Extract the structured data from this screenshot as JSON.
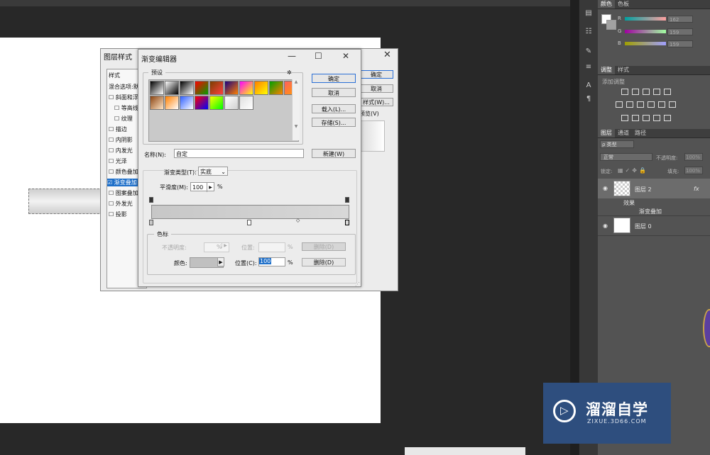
{
  "panels": {
    "color_tabs": [
      "颜色",
      "色板"
    ],
    "channels": [
      {
        "label": "R",
        "value": "162"
      },
      {
        "label": "G",
        "value": "159"
      },
      {
        "label": "B",
        "value": "159"
      }
    ],
    "adjust_tabs": [
      "调整",
      "样式"
    ],
    "adjust_title": "添加调整",
    "layers_tabs": [
      "图层",
      "通道",
      "路径"
    ],
    "filter_label": "ρ 类型",
    "blend_mode": "正常",
    "opacity_label": "不透明度:",
    "opacity_value": "100%",
    "lock_label": "锁定:",
    "fill_label": "填充:",
    "fill_value": "100%",
    "layers": [
      {
        "name": "图层 2",
        "fx": "fx"
      },
      {
        "name": "图层 0"
      }
    ],
    "effects_label": "效果",
    "effect_item": "渐变叠加"
  },
  "layer_style": {
    "title": "图层样式",
    "list_header": "样式",
    "items": [
      {
        "label": "混合选项:默"
      },
      {
        "label": "☐ 斜面和浮"
      },
      {
        "label": "☐ 等高线"
      },
      {
        "label": "☐ 纹理"
      },
      {
        "label": "☐ 描边"
      },
      {
        "label": "☐ 内阴影"
      },
      {
        "label": "☐ 内发光"
      },
      {
        "label": "☐ 光泽"
      },
      {
        "label": "☐ 颜色叠加"
      },
      {
        "label": "☑ 渐变叠加"
      },
      {
        "label": "☐ 图案叠加"
      },
      {
        "label": "☐ 外发光"
      },
      {
        "label": "☐ 投影"
      }
    ],
    "buttons": [
      "确定",
      "取消",
      "样式(W)...",
      "预览(V)"
    ]
  },
  "gradient_editor": {
    "title": "渐变编辑器",
    "presets_label": "预设",
    "buttons": {
      "ok": "确定",
      "cancel": "取消",
      "load": "载入(L)...",
      "save": "存储(S)...",
      "new": "新建(W)"
    },
    "name_label": "名称(N):",
    "name_value": "自定",
    "type_label": "渐变类型(T):",
    "type_value": "实底",
    "smooth_label": "平滑度(M):",
    "smooth_value": "100",
    "percent": "%",
    "stops_label": "色标",
    "opacity_label": "不透明度:",
    "location_label": "位置:",
    "delete_label": "删除(D)",
    "color_label": "颜色:",
    "color_location_label": "位置(C):",
    "color_location_value": "100",
    "color_delete_label": "删除(D)",
    "swatch_colors": [
      [
        "#000000",
        "#ffffff"
      ],
      [
        "#ffffff",
        "#000000"
      ],
      [
        "#000000",
        "#ffffff"
      ],
      [
        "#ff0000",
        "#00a000"
      ],
      [
        "#7b3f00",
        "#ff4040"
      ],
      [
        "#1a0080",
        "#ff8000"
      ],
      [
        "#ff00ff",
        "#ffff00"
      ],
      [
        "#ff8000",
        "#ffff00"
      ],
      [
        "#00a000",
        "#ff8000"
      ],
      [
        "#ff6060",
        "#ffa000"
      ],
      [
        "#8b4513",
        "#ffe4c4"
      ],
      [
        "#ff8000",
        "#ffffff"
      ],
      [
        "#3060ff",
        "#ffffff"
      ],
      [
        "#ff0000",
        "#0000ff"
      ],
      [
        "#ffff00",
        "#00ff00"
      ],
      [
        "#ffffff",
        "#d0d0d0"
      ],
      [
        "#e0e0e0",
        "#ffffff"
      ]
    ]
  },
  "watermark": {
    "title": "溜溜自学",
    "url": "ZIXUE.3D66.COM"
  }
}
